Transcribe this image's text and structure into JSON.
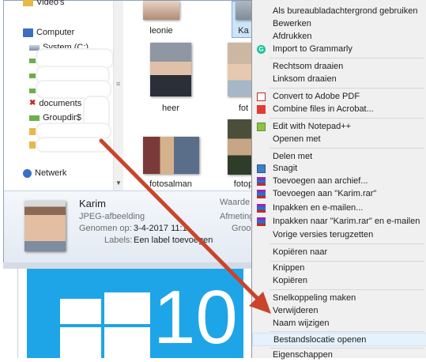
{
  "nav": {
    "items": [
      {
        "label": "Video's"
      },
      {
        "label": "Computer"
      },
      {
        "label": "System (C:)"
      },
      {
        "label": "documents"
      },
      {
        "label": "Groupdir$"
      },
      {
        "label": "Netwerk"
      }
    ]
  },
  "thumbnails": [
    {
      "label": "leonie"
    },
    {
      "label": "Ka"
    },
    {
      "label": "heer"
    },
    {
      "label": "fot"
    },
    {
      "label": "fotosalman"
    },
    {
      "label": "fotop"
    }
  ],
  "details": {
    "name": "Karim",
    "type": "JPEG-afbeelding",
    "taken_label": "Genomen op:",
    "taken_value": "3-4-2017 11:1",
    "labels_label": "Labels:",
    "labels_value": "Een label toevoegen",
    "right_1": "Waarde",
    "right_2": "Afmeting",
    "right_3": "Groo"
  },
  "win10": {
    "number": "10"
  },
  "context_menu": {
    "items": [
      {
        "label": "Als bureaubladachtergrond gebruiken"
      },
      {
        "label": "Bewerken"
      },
      {
        "label": "Afdrukken"
      },
      {
        "label": "Import to Grammarly"
      },
      {
        "label": "Rechtsom draaien"
      },
      {
        "label": "Linksom draaien"
      },
      {
        "label": "Convert to Adobe PDF"
      },
      {
        "label": "Combine files in Acrobat..."
      },
      {
        "label": "Edit with Notepad++"
      },
      {
        "label": "Openen met"
      },
      {
        "label": "Delen met"
      },
      {
        "label": "Snagit"
      },
      {
        "label": "Toevoegen aan archief..."
      },
      {
        "label": "Toevoegen aan \"Karim.rar\""
      },
      {
        "label": "Inpakken en e-mailen..."
      },
      {
        "label": "Inpakken naar \"Karim.rar\" en e-mailen"
      },
      {
        "label": "Vorige versies terugzetten"
      },
      {
        "label": "Kopiëren naar"
      },
      {
        "label": "Knippen"
      },
      {
        "label": "Kopiëren"
      },
      {
        "label": "Snelkoppeling maken"
      },
      {
        "label": "Verwijderen"
      },
      {
        "label": "Naam wijzigen"
      },
      {
        "label": "Bestandslocatie openen"
      },
      {
        "label": "Eigenschappen"
      }
    ]
  },
  "colors": {
    "accent_arrow": "#c8452b",
    "win10_tile": "#1ea5e8",
    "menu_bg": "#f0f0f0",
    "selection": "#cce4f7"
  }
}
